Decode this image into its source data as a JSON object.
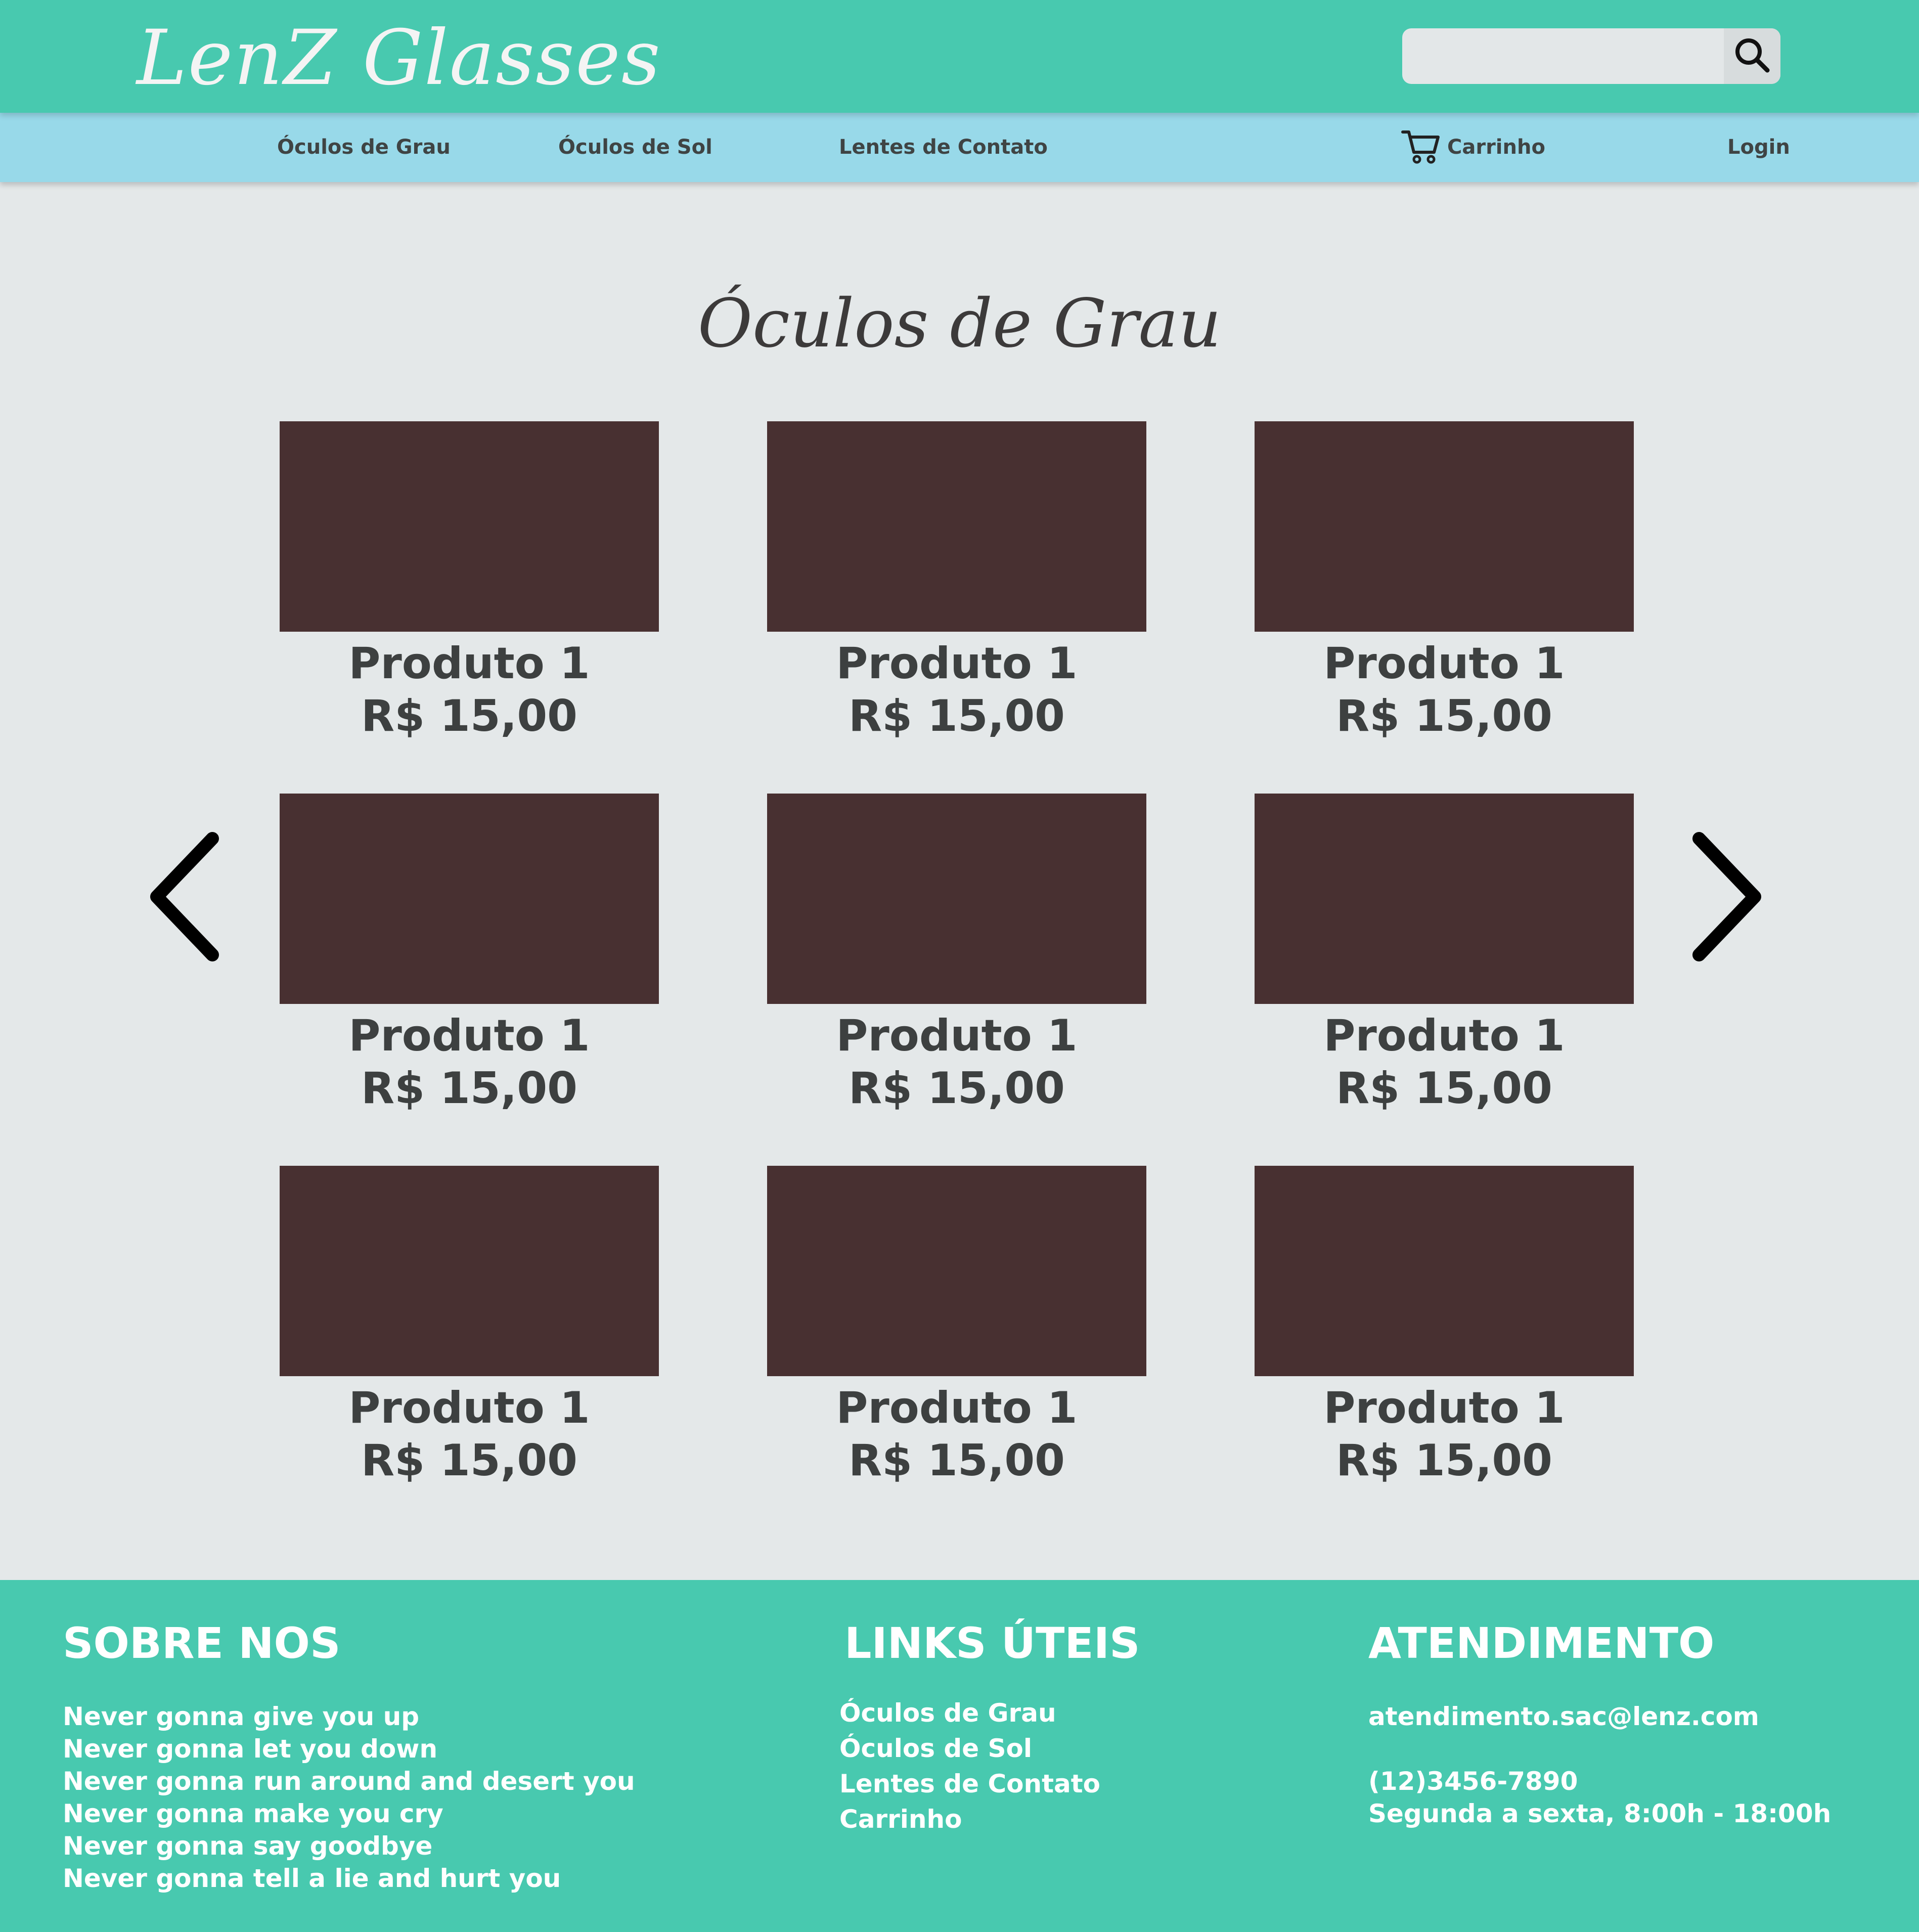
{
  "header": {
    "logo": "LenZ  Glasses",
    "search": {
      "placeholder": "",
      "value": ""
    }
  },
  "nav": {
    "items": [
      "Óculos de Grau",
      "Óculos de Sol",
      "Lentes de Contato"
    ],
    "cart_label": "Carrinho",
    "login_label": "Login"
  },
  "main": {
    "title": "Óculos de Grau",
    "products": [
      {
        "name": "Produto 1",
        "price": "R$ 15,00"
      },
      {
        "name": "Produto 1",
        "price": "R$ 15,00"
      },
      {
        "name": "Produto 1",
        "price": "R$ 15,00"
      },
      {
        "name": "Produto 1",
        "price": "R$ 15,00"
      },
      {
        "name": "Produto 1",
        "price": "R$ 15,00"
      },
      {
        "name": "Produto 1",
        "price": "R$ 15,00"
      },
      {
        "name": "Produto 1",
        "price": "R$ 15,00"
      },
      {
        "name": "Produto 1",
        "price": "R$ 15,00"
      },
      {
        "name": "Produto 1",
        "price": "R$ 15,00"
      }
    ]
  },
  "footer": {
    "about": {
      "heading": "SOBRE NOS",
      "lines": [
        "Never gonna give you up",
        "Never gonna let you down",
        "Never gonna run around and desert you",
        "Never gonna make you cry",
        "Never gonna say goodbye",
        "Never gonna tell a lie and hurt you"
      ]
    },
    "links": {
      "heading": "LINKS ÚTEIS",
      "items": [
        "Óculos de Grau",
        "Óculos de Sol",
        "Lentes de Contato",
        "Carrinho"
      ]
    },
    "contact": {
      "heading": "ATENDIMENTO",
      "email": "atendimento.sac@lenz.com",
      "phone": "(12)3456-7890",
      "hours": "Segunda a sexta, 8:00h - 18:00h"
    }
  },
  "colors": {
    "header_bg": "#48c9af",
    "nav_bg": "#98d9e9",
    "page_bg": "#e4e8e9",
    "product_image": "#483031",
    "text_dark": "#3d4040"
  },
  "icons": {
    "search": "search-icon",
    "cart": "cart-icon",
    "prev": "chevron-left-icon",
    "next": "chevron-right-icon"
  }
}
